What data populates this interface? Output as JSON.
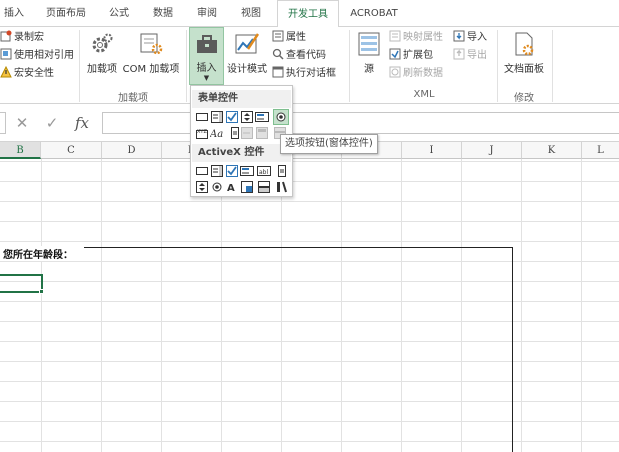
{
  "tabs": [
    "插入",
    "页面布局",
    "公式",
    "数据",
    "审阅",
    "视图",
    "开发工具",
    "ACROBAT"
  ],
  "active_tab": "开发工具",
  "code_group": {
    "items": [
      "录制宏",
      "使用相对引用",
      "宏安全性"
    ]
  },
  "addins_group": {
    "label": "加载项",
    "addins_button": "加载项",
    "com_button": "COM 加载项"
  },
  "controls_group": {
    "insert_button": "插入",
    "design_mode_button": "设计模式",
    "properties": "属性",
    "view_code": "查看代码",
    "run_dialog": "执行对话框"
  },
  "xml_group": {
    "label": "XML",
    "source_button": "源",
    "map_properties": "映射属性",
    "expansion_packs": "扩展包",
    "refresh_data": "刷新数据",
    "import": "导入",
    "export": "导出"
  },
  "modify_group": {
    "label": "修改",
    "document_panel": "文档面板"
  },
  "formula_bar": {
    "cancel_icon": "✕",
    "enter_icon": "✓",
    "fx": "fx",
    "value": ""
  },
  "columns": [
    "B",
    "C",
    "D",
    "E",
    "F",
    "G",
    "H",
    "I",
    "J",
    "K",
    "L"
  ],
  "selected_column": "B",
  "cell_text": "您所在年龄段：",
  "dropdown": {
    "form_controls_header": "表单控件",
    "activex_header": "ActiveX 控件",
    "form_controls_icons": [
      "button",
      "combo-box",
      "checkbox",
      "spin-button",
      "list-box",
      "option-button",
      "group-box",
      "label",
      "scroll-bar",
      "text-field",
      "combo-list-edit",
      "combo-dropdown-edit"
    ],
    "activex_icons": [
      "command-button",
      "combo-box",
      "checkbox",
      "list-box",
      "text-box",
      "scroll-bar",
      "spin-button",
      "option-button",
      "label",
      "image",
      "toggle-button",
      "more-controls"
    ],
    "highlighted": "option-button"
  },
  "tooltip": "选项按钮(窗体控件)",
  "colors": {
    "accent": "#217346",
    "ribbon_insert_bg": "#c5e1cc"
  }
}
